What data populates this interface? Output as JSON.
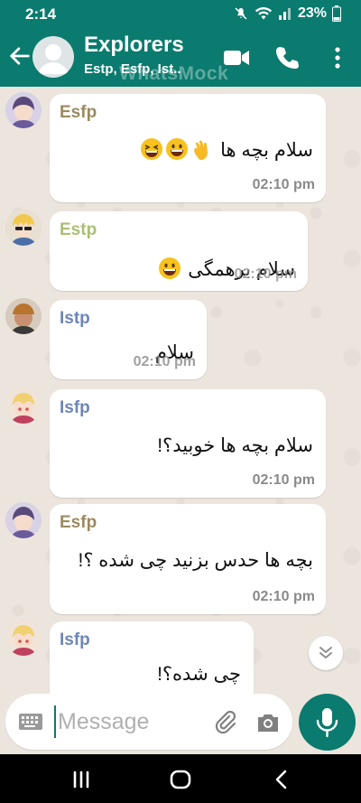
{
  "status": {
    "time": "2:14",
    "battery": "23%"
  },
  "header": {
    "title": "Explorers",
    "subtitle": "Estp, Esfp, Ist..",
    "watermark": "WhatsMock"
  },
  "messages": [
    {
      "sender": "Esfp",
      "sender_color": "#9b8a5e",
      "text": "سلام بچه ها",
      "emojis": [
        "waving-hand",
        "grinning",
        "laughing"
      ],
      "time": "02:10 pm"
    },
    {
      "sender": "Estp",
      "sender_color": "#a9bf72",
      "text": "سلام برهمگی",
      "emojis": [
        "grinning"
      ],
      "time": "02:10 pm"
    },
    {
      "sender": "Istp",
      "sender_color": "#6e86b8",
      "text": "سلام",
      "emojis": [],
      "time": "02:10 pm"
    },
    {
      "sender": "Isfp",
      "sender_color": "#6e86b8",
      "text": "سلام بچه ها خوبید؟!",
      "emojis": [],
      "time": "02:10 pm"
    },
    {
      "sender": "Esfp",
      "sender_color": "#9b8a5e",
      "text": "بچه ها حدس بزنید چی شده ؟!",
      "emojis": [],
      "time": "02:10 pm"
    },
    {
      "sender": "Isfp",
      "sender_color": "#6e86b8",
      "text": "چی شده؟!",
      "emojis": [],
      "time": ""
    }
  ],
  "composer": {
    "placeholder": "Message"
  },
  "colors": {
    "primary": "#0a7b6e",
    "chat_bg": "#ece5dd",
    "bubble": "#ffffff"
  }
}
